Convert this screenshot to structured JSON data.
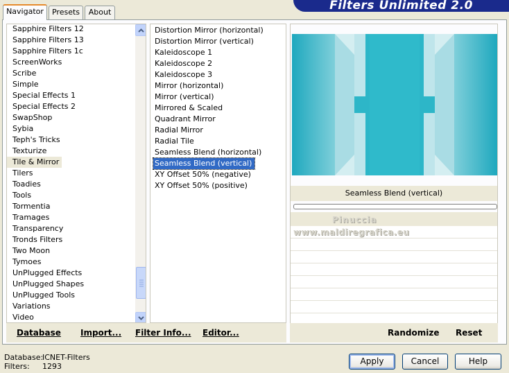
{
  "tabs": [
    {
      "label": "Navigator"
    },
    {
      "label": "Presets"
    },
    {
      "label": "About"
    }
  ],
  "banner": {
    "title": "Filters Unlimited 2.0"
  },
  "categories": [
    "Sapphire Filters 12",
    "Sapphire Filters 13",
    "Sapphire Filters 1c",
    "ScreenWorks",
    "Scribe",
    "Simple",
    "Special Effects 1",
    "Special Effects 2",
    "SwapShop",
    "Sybia",
    "Teph's Tricks",
    "Texturize",
    "Tile & Mirror",
    "Tilers",
    "Toadies",
    "Tools",
    "Tormentia",
    "Tramages",
    "Transparency",
    "Tronds Filters",
    "Two Moon",
    "Tymoes",
    "UnPlugged Effects",
    "UnPlugged Shapes",
    "UnPlugged Tools",
    "Variations",
    "Video"
  ],
  "selected_category": "Tile & Mirror",
  "filters": [
    "Distortion Mirror (horizontal)",
    "Distortion Mirror (vertical)",
    "Kaleidoscope 1",
    "Kaleidoscope 2",
    "Kaleidoscope 3",
    "Mirror (horizontal)",
    "Mirror (vertical)",
    "Mirrored & Scaled",
    "Quadrant Mirror",
    "Radial Mirror",
    "Radial Tile",
    "Seamless Blend (horizontal)",
    "Seamless Blend (vertical)",
    "XY Offset 50% (negative)",
    "XY Offset 50% (positive)"
  ],
  "selected_filter": "Seamless Blend (vertical)",
  "preview": {
    "filter_name": "Seamless Blend (vertical)",
    "watermark_line1": "Pinuccia",
    "watermark_line2": "www.maldiregrafica.eu"
  },
  "left_bottom": {
    "database": "Database",
    "import": "Import...",
    "filter_info": "Filter Info...",
    "editor": "Editor..."
  },
  "right_bottom": {
    "randomize": "Randomize",
    "reset": "Reset"
  },
  "status": {
    "database_label": "Database:",
    "database_value": "ICNET-Filters",
    "filters_label": "Filters:",
    "filters_value": "1293"
  },
  "dialog_buttons": {
    "apply": "Apply",
    "cancel": "Cancel",
    "help": "Help"
  },
  "colors": {
    "banner": "#1A2A8C",
    "selection": "#316AC5",
    "preview_teal": "#2DB6C8"
  }
}
